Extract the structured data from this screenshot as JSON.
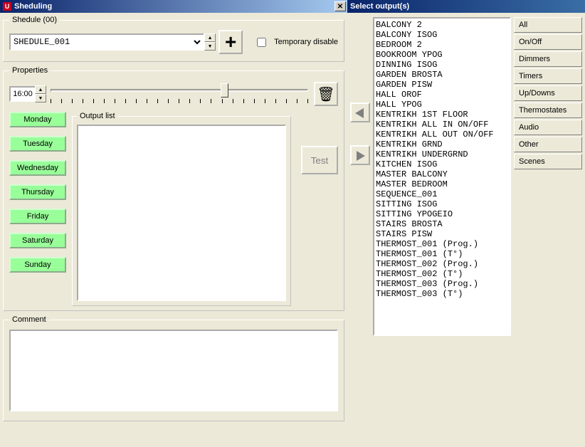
{
  "left": {
    "window_title": "Sheduling",
    "shedule_group": "Shedule (00)",
    "shedule_value": "SHEDULE_001",
    "plus_label": "+",
    "temp_disable_label": "Temporary disable",
    "properties_group": "Properties",
    "time_value": "16:00",
    "trash_glyph": "🗑",
    "days": [
      "Monday",
      "Tuesday",
      "Wednesday",
      "Thursday",
      "Friday",
      "Saturday",
      "Sunday"
    ],
    "output_list_group": "Output list",
    "test_label": "Test",
    "comment_group": "Comment"
  },
  "right": {
    "window_title": "Select output(s)",
    "items": [
      "BALCONY 2",
      "BALCONY ISOG",
      "BEDROOM 2",
      "BOOKROOM YPOG",
      "DINNING ISOG",
      "GARDEN BROSTA",
      "GARDEN PISW",
      "HALL OROF",
      "HALL YPOG",
      "KENTRIKH 1ST FLOOR",
      "KENTRIKH ALL IN ON/OFF",
      "KENTRIKH ALL OUT ON/OFF",
      "KENTRIKH GRND",
      "KENTRIKH UNDERGRND",
      "KITCHEN ISOG",
      "MASTER BALCONY",
      "MASTER BEDROOM",
      "SEQUENCE_001",
      "SITTING ISOG",
      "SITTING YPOGEIO",
      "STAIRS BROSTA",
      "STAIRS PISW",
      "THERMOST_001 (Prog.)",
      "THERMOST_001 (T°)",
      "THERMOST_002 (Prog.)",
      "THERMOST_002 (T°)",
      "THERMOST_003 (Prog.)",
      "THERMOST_003 (T°)"
    ],
    "filters": [
      "All",
      "On/Off",
      "Dimmers",
      "Timers",
      "Up/Downs",
      "Thermostates",
      "Audio",
      "Other",
      "Scenes"
    ]
  }
}
